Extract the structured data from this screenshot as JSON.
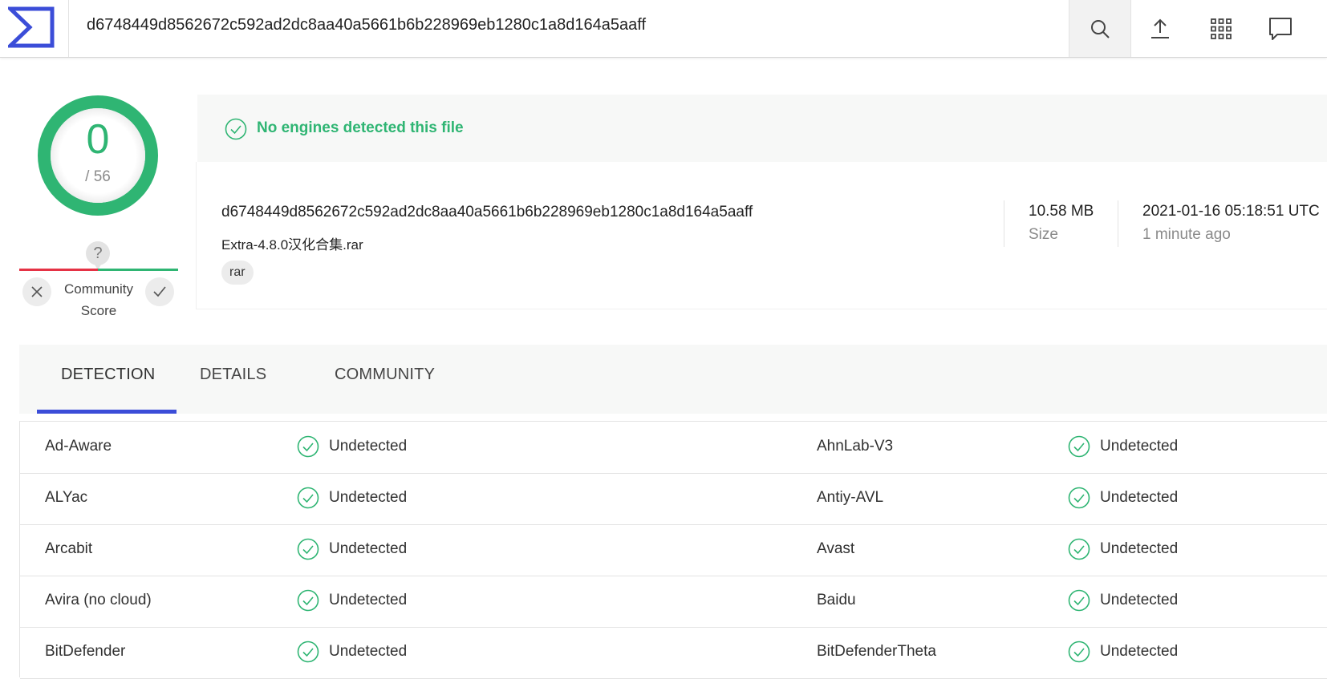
{
  "header": {
    "search_value": "d6748449d8562672c592ad2dc8aa40a5661b6b228969eb1280c1a8d164a5aaff",
    "icons": [
      "logo-icon",
      "search-icon",
      "upload-icon",
      "apps-grid-icon",
      "chat-icon"
    ]
  },
  "score": {
    "detections": "0",
    "total": "/ 56",
    "ring_color": "#2fb573"
  },
  "community_score": {
    "question_mark": "?",
    "label": "Community Score",
    "negative_color": "#e53245",
    "positive_color": "#2fb573"
  },
  "banner": {
    "text": "No engines detected this file"
  },
  "file": {
    "hash": "d6748449d8562672c592ad2dc8aa40a5661b6b228969eb1280c1a8d164a5aaff",
    "name": "Extra-4.8.0汉化合集.rar",
    "tag": "rar",
    "size_value": "10.58 MB",
    "size_label": "Size",
    "date_value": "2021-01-16 05:18:51 UTC",
    "date_label": "1 minute ago"
  },
  "tabs": [
    {
      "label": "DETECTION",
      "active": true
    },
    {
      "label": "DETAILS",
      "active": false
    },
    {
      "label": "COMMUNITY",
      "active": false
    }
  ],
  "accent_color": "#3b4dd8",
  "results": [
    {
      "left_engine": "Ad-Aware",
      "left_status": "Undetected",
      "right_engine": "AhnLab-V3",
      "right_status": "Undetected"
    },
    {
      "left_engine": "ALYac",
      "left_status": "Undetected",
      "right_engine": "Antiy-AVL",
      "right_status": "Undetected"
    },
    {
      "left_engine": "Arcabit",
      "left_status": "Undetected",
      "right_engine": "Avast",
      "right_status": "Undetected"
    },
    {
      "left_engine": "Avira (no cloud)",
      "left_status": "Undetected",
      "right_engine": "Baidu",
      "right_status": "Undetected"
    },
    {
      "left_engine": "BitDefender",
      "left_status": "Undetected",
      "right_engine": "BitDefenderTheta",
      "right_status": "Undetected"
    }
  ]
}
